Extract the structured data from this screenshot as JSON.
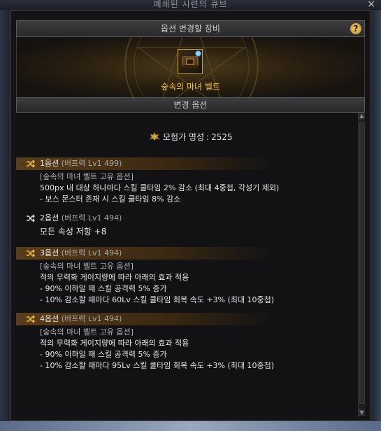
{
  "background": {
    "title_fragment": "폐쇄된 시련의 큐브",
    "close_glyph": "×"
  },
  "header": {
    "title": "옵션 변경할 장비",
    "help_label": "?"
  },
  "item": {
    "name": "숲속의 마녀 벨트",
    "icon": "belt-icon"
  },
  "section": {
    "title": "변경 옵션"
  },
  "fame": {
    "label": "모험가 명성",
    "value": "2525",
    "icon": "fame-crest-icon"
  },
  "options": [
    {
      "label": "1옵션",
      "grade": "(버프력 Lv1 499)",
      "lines": [
        "[숲속의 마녀 벨트 고유 옵션]",
        "500px 내 대상 하나마다 스킬 쿨타임 2% 감소 (최대 4중첩, 각성기 제외)",
        "- 보스 몬스터 존재 시 스킬 쿨타임 8% 감소"
      ]
    },
    {
      "label": "2옵션",
      "grade": "(버프력 Lv1 494)",
      "lines": [
        "모든 속성 저항 +8"
      ]
    },
    {
      "label": "3옵션",
      "grade": "(버프력 Lv1 494)",
      "lines": [
        "[숲속의 마녀 벨트 고유 옵션]",
        "적의 무력화 게이지량에 따라 아래의 효과 적용",
        "- 90% 이하일 때 스킬 공격력 5% 증가",
        "- 10% 감소할 때마다 60Lv 스킬 쿨타임 회복 속도 +3% (최대 10중첩)"
      ]
    },
    {
      "label": "4옵션",
      "grade": "(버프력 Lv1 494)",
      "lines": [
        "[숲속의 마녀 벨트 고유 옵션]",
        "적의 무력화 게이지량에 따라 아래의 효과 적용",
        "- 90% 이하일 때 스킬 공격력 5% 증가",
        "- 10% 감소할 때마다 95Lv 스킬 쿨타임 회복 속도 +3% (최대 10중첩)"
      ]
    }
  ],
  "colors": {
    "accent_gold": "#f2c14a",
    "text": "#e6e6e6",
    "muted": "#a9a9a9"
  }
}
